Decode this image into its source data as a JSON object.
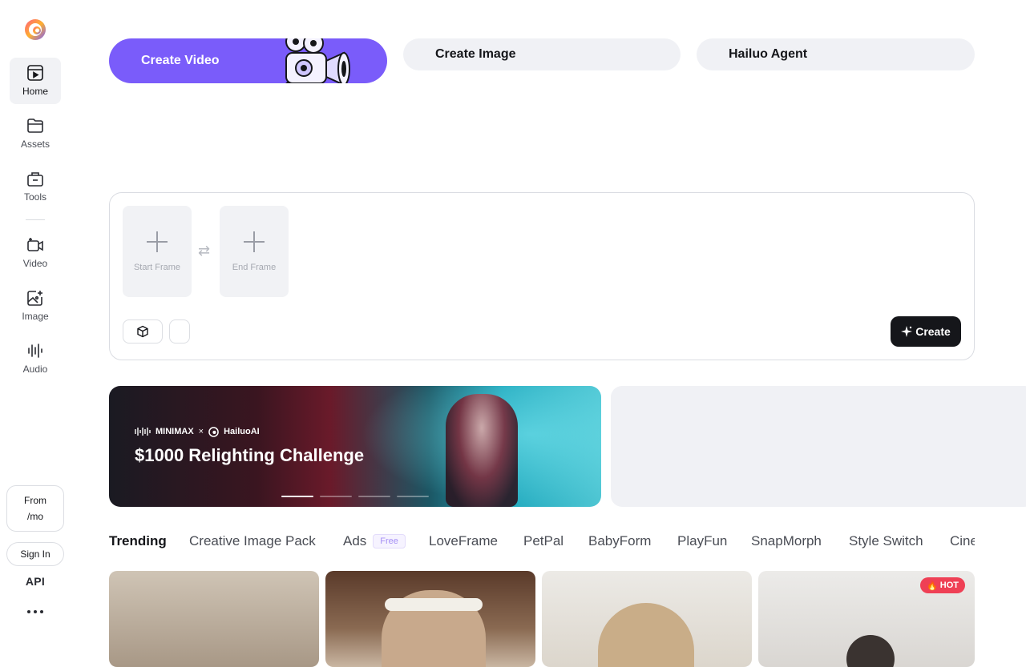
{
  "sidebar": {
    "items": [
      {
        "label": "Home",
        "icon": "home-icon"
      },
      {
        "label": "Assets",
        "icon": "folder-icon"
      },
      {
        "label": "Tools",
        "icon": "toolbox-icon"
      },
      {
        "label": "Video",
        "icon": "video-icon"
      },
      {
        "label": "Image",
        "icon": "image-icon"
      },
      {
        "label": "Audio",
        "icon": "audio-icon"
      }
    ],
    "from_line1": "From",
    "from_line2": "/mo",
    "signin": "Sign In",
    "api": "API"
  },
  "tabs": {
    "create_video": "Create Video",
    "create_image": "Create Image",
    "agent": "Hailuo Agent"
  },
  "prompt": {
    "start_frame": "Start Frame",
    "end_frame": "End Frame",
    "create": "Create"
  },
  "banner": {
    "brand1": "MINIMAX",
    "separator": "×",
    "brand2": "HailuoAI",
    "headline": "$1000 Relighting Challenge"
  },
  "categories": [
    "Trending",
    "Creative Image Pack",
    "Ads",
    "LoveFrame",
    "PetPal",
    "BabyForm",
    "PlayFun",
    "SnapMorph",
    "Style Switch",
    "Cine"
  ],
  "free_badge": "Free",
  "hot_badge": "HOT",
  "colors": {
    "accent": "#7a5cfa",
    "hot": "#ef4055",
    "dark": "#15161a"
  }
}
